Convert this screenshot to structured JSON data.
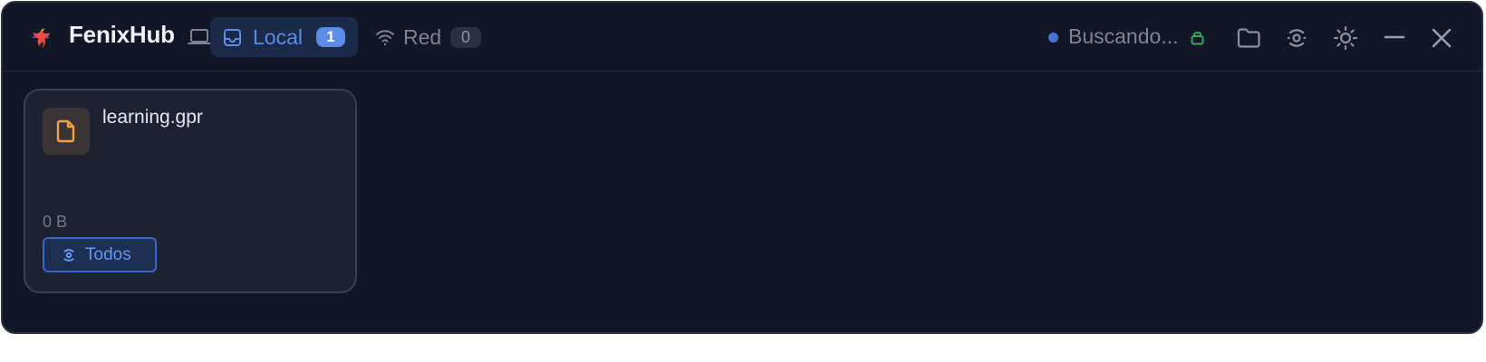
{
  "app": {
    "title": "FenixHub",
    "icons": {
      "logo": "phoenix-logo",
      "device": "laptop-icon"
    }
  },
  "tabs": [
    {
      "label": "Local",
      "count": "1",
      "icon": "inbox-icon",
      "selected": true
    },
    {
      "label": "Red",
      "count": "0",
      "icon": "wifi-icon",
      "selected": false
    }
  ],
  "status": {
    "text": "Buscando...",
    "dot_color": "#4774d4",
    "lock_icon": "lock-icon",
    "lock_color": "#37a857"
  },
  "actions": [
    {
      "icon": "folder-icon"
    },
    {
      "icon": "broadcast-icon"
    },
    {
      "icon": "settings-icon"
    },
    {
      "icon": "minimize-icon"
    },
    {
      "icon": "close-icon"
    }
  ],
  "files": [
    {
      "name": "learning.gpr",
      "size": "0 B",
      "icon": "file-icon",
      "share_label": "Todos",
      "share_icon": "broadcast-icon"
    }
  ],
  "colors": {
    "background": "#111726",
    "accent": "#5b8ce8",
    "card_background": "#1e2230",
    "file_icon": "#f0a04b"
  }
}
